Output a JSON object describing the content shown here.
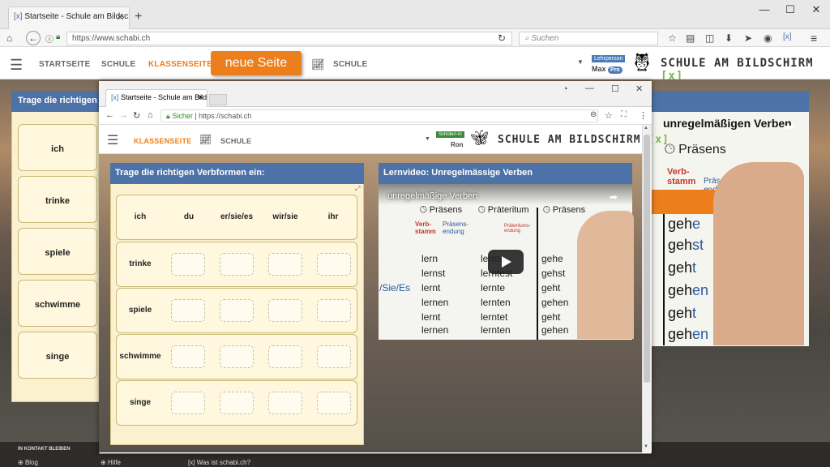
{
  "browser": {
    "tab_title": "Startseite - Schule am Bildsc",
    "url": "https://www.schabi.ch",
    "search_placeholder": "Suchen"
  },
  "site_nav": {
    "startseite": "STARTSEITE",
    "schule": "SCHULE",
    "klassenseite": "KLASSENSEITE",
    "neue_seite": "neue Seite",
    "schule2": "SCHULE",
    "user_role": "Lehrperson",
    "user_name": "Max",
    "user_badge": "Pro",
    "logo_text": "SCHULE AM BILDSCHIRM",
    "logo_mark": "[x]"
  },
  "left_panel": {
    "heading": "Trage die richtigen",
    "rows": [
      "ich",
      "trinke",
      "spiele",
      "schwimme",
      "singe"
    ]
  },
  "right_panel": {
    "heading": "unregelmäßigen Verben",
    "tense": "Präsens",
    "stem_label": "Verb-stamm",
    "ending_label": "Präsens-endung",
    "verbs": [
      {
        "stem": "geh",
        "ending": "e"
      },
      {
        "stem": "geh",
        "ending": "st"
      },
      {
        "stem": "geh",
        "ending": "t"
      },
      {
        "stem": "geh",
        "ending": "en"
      },
      {
        "stem": "geh",
        "ending": "t"
      },
      {
        "stem": "geh",
        "ending": "en"
      }
    ]
  },
  "footer": {
    "stay_in_touch": "IN KONTAKT BLEIBEN",
    "blog": "Blog",
    "hilfe": "Hilfe",
    "was_ist": "Was ist schabi.ch?"
  },
  "inner_window": {
    "tab_title": "Startseite - Schule am Bildsc",
    "secure_label": "Sicher",
    "url": "https://schabi.ch",
    "nav_klassenseite": "KLASSENSEITE",
    "nav_schule": "SCHULE",
    "user_role": "Schüler/-in",
    "user_name": "Ron",
    "logo_text": "SCHULE AM BILDSCHIRM",
    "logo_mark": "[x]"
  },
  "task": {
    "heading": "Trage die richtigen Verbformen ein:",
    "columns": [
      "ich",
      "du",
      "er/sie/es",
      "wir/sie",
      "ihr"
    ],
    "rows": [
      "trinke",
      "spiele",
      "schwimme",
      "singe"
    ]
  },
  "video": {
    "heading": "Lernvideo: Unregelmässige Verben",
    "title": "unregelmäßige Verben",
    "col1_tense": "Präsens",
    "col2_tense": "Präteritum",
    "col3_tense": "Präsens",
    "stem_label": "Verb-stamm",
    "ending1": "Präsens-endung",
    "ending2": "Präteritums-endung",
    "pronouns": "/Sie/Es",
    "col1": [
      "lern",
      "lernst",
      "lernt",
      "lernen",
      "lernt",
      "lernen"
    ],
    "col2": [
      "lernte",
      "lerntest",
      "lernte",
      "lernten",
      "lerntet",
      "lernten"
    ],
    "col3": [
      "gehe",
      "gehst",
      "geht",
      "gehen",
      "geht",
      "gehen"
    ]
  },
  "colors": {
    "accent_orange": "#ec7f1c",
    "header_blue": "#4d72a8",
    "cell_cream": "#fff8de"
  }
}
